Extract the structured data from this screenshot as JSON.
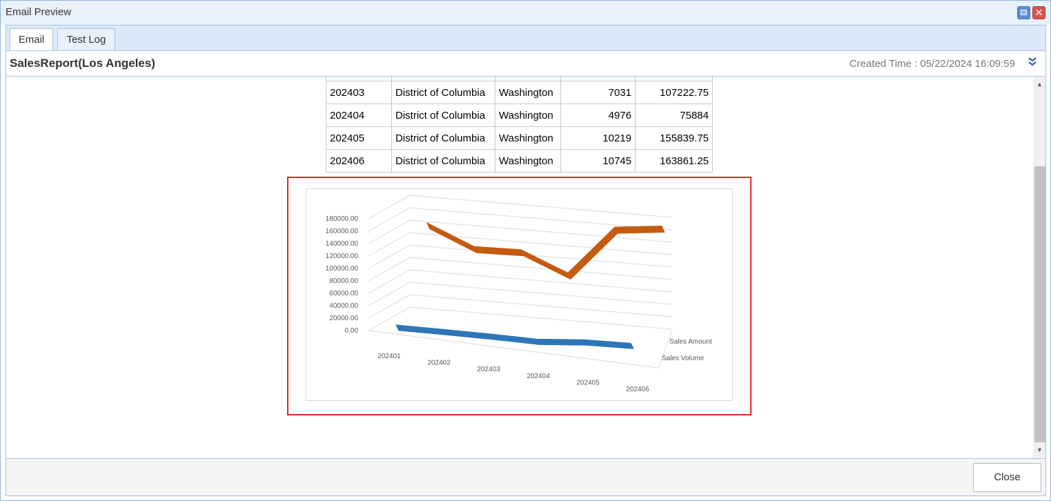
{
  "window": {
    "title": "Email Preview",
    "close_glyph": "✕"
  },
  "tabs": [
    {
      "label": "Email"
    },
    {
      "label": "Test Log"
    }
  ],
  "header": {
    "report_title": "SalesReport(Los Angeles)",
    "created_time": "Created Time : 05/22/2024 16:09:59",
    "expand_icon": "double-chevron-down-icon"
  },
  "table": {
    "rows": [
      [
        "202403",
        "District of Columbia",
        "Washington",
        "7031",
        "107222.75"
      ],
      [
        "202404",
        "District of Columbia",
        "Washington",
        "4976",
        "75884"
      ],
      [
        "202405",
        "District of Columbia",
        "Washington",
        "10219",
        "155839.75"
      ],
      [
        "202406",
        "District of Columbia",
        "Washington",
        "10745",
        "163861.25"
      ]
    ]
  },
  "chart_data": {
    "type": "line",
    "categories": [
      "202401",
      "202402",
      "202403",
      "202404",
      "202405",
      "202406"
    ],
    "y_ticks": [
      "0.00",
      "20000.00",
      "40000.00",
      "60000.00",
      "80000.00",
      "100000.00",
      "120000.00",
      "140000.00",
      "160000.00",
      "180000.00"
    ],
    "ylim": [
      0,
      180000
    ],
    "series": [
      {
        "name": "Sales Amount",
        "values": [
          138000,
          106000,
          107222.75,
          75884,
          155839.75,
          163861.25
        ],
        "color": "#c55a11"
      },
      {
        "name": "Sales Volume",
        "values": [
          9000,
          8200,
          7031,
          4976,
          10219,
          10745
        ],
        "color": "#2e75b6"
      }
    ]
  },
  "footer": {
    "close_label": "Close"
  }
}
